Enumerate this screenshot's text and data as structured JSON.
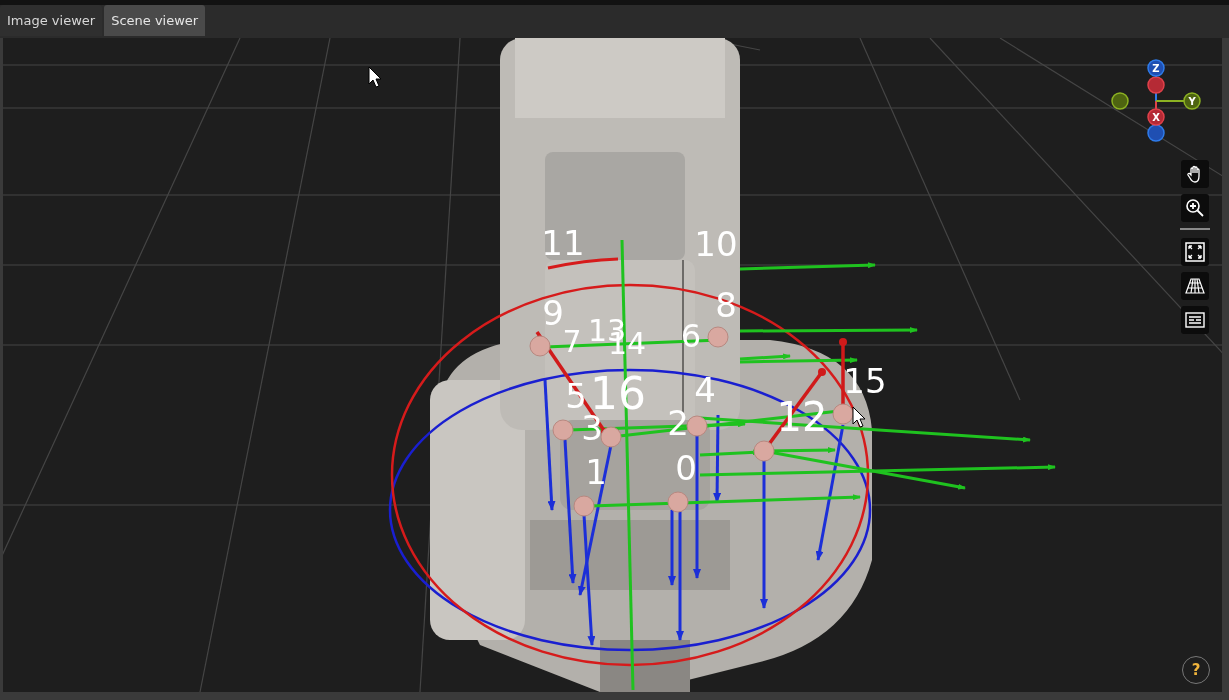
{
  "tabs": [
    {
      "label": "Image viewer",
      "selected": false
    },
    {
      "label": "Scene viewer",
      "selected": true
    }
  ],
  "scene": {
    "point_labels": [
      "11",
      "10",
      "9",
      "8",
      "7",
      "13",
      "14",
      "6",
      "5",
      "16",
      "4",
      "15",
      "3",
      "2",
      "12",
      "1",
      "0"
    ],
    "axis_gizmo": {
      "z": "Z",
      "y": "Y",
      "x": "X"
    }
  },
  "toolbar": {
    "groups": [
      {
        "tools": [
          {
            "kind": "pan"
          },
          {
            "kind": "zoom"
          }
        ]
      },
      {
        "tools": [
          {
            "kind": "fit"
          },
          {
            "kind": "grid"
          },
          {
            "kind": "list"
          }
        ]
      }
    ]
  },
  "help_button": {
    "label": "?"
  }
}
